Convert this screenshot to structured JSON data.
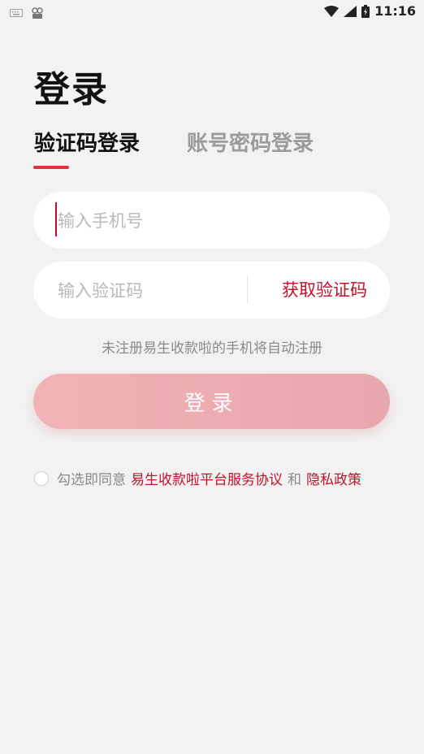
{
  "status_bar": {
    "time": "11:16"
  },
  "page": {
    "title": "登录"
  },
  "tabs": [
    {
      "label": "验证码登录"
    },
    {
      "label": "账号密码登录"
    }
  ],
  "phone_field": {
    "placeholder": "输入手机号",
    "value": ""
  },
  "code_field": {
    "placeholder": "输入验证码",
    "value": "",
    "get_code_label": "获取验证码"
  },
  "hint": "未注册易生收款啦的手机将自动注册",
  "login_button": {
    "label": "登录"
  },
  "agreement": {
    "prefix": "勾选即同意",
    "service_link": "易生收款啦平台服务协议",
    "and": "和",
    "privacy_link": "隐私政策"
  },
  "colors": {
    "accent": "#c1122b",
    "underline": "#d9363e",
    "button_gradient_start": "#f1b3b6",
    "button_gradient_end": "#e8a6ad"
  }
}
